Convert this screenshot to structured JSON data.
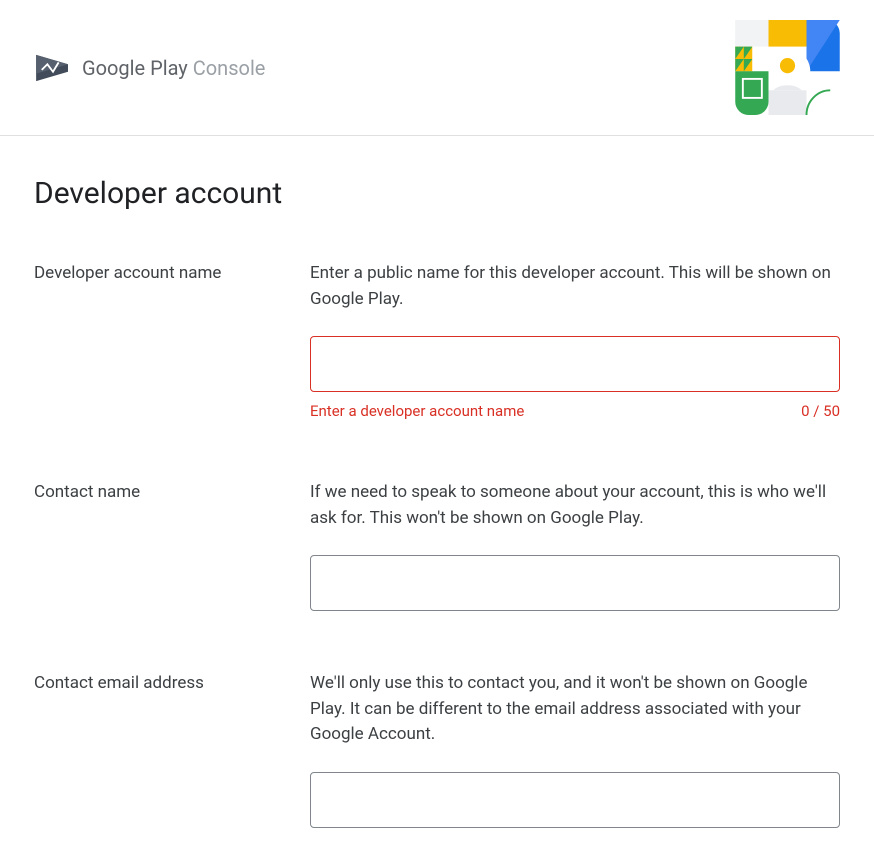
{
  "header": {
    "brand_primary": "Google Play",
    "brand_secondary": " Console"
  },
  "page": {
    "title": "Developer account"
  },
  "fields": {
    "account_name": {
      "label": "Developer account name",
      "help": "Enter a public name for this developer account. This will be shown on Google Play.",
      "value": "",
      "error": "Enter a developer account name",
      "counter": "0 / 50"
    },
    "contact_name": {
      "label": "Contact name",
      "help": "If we need to speak to someone about your account, this is who we'll ask for. This won't be shown on Google Play.",
      "value": ""
    },
    "contact_email": {
      "label": "Contact email address",
      "help": "We'll only use this to contact you, and it won't be shown on Google Play. It can be different to the email address associated with your Google Account.",
      "value": ""
    }
  }
}
